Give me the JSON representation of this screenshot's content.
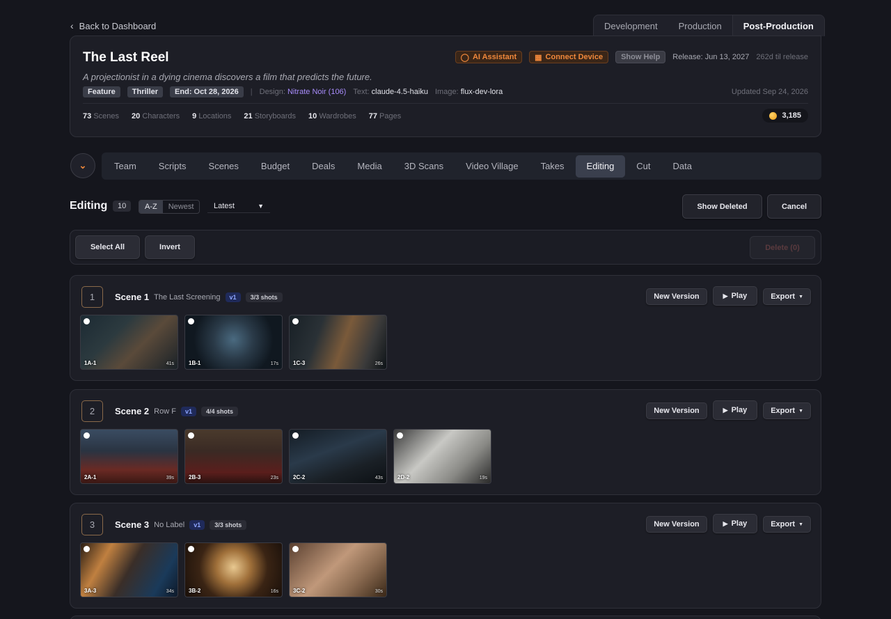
{
  "back_label": "Back to Dashboard",
  "phases": [
    "Development",
    "Production",
    "Post-Production"
  ],
  "active_phase": "Post-Production",
  "project": {
    "title": "The Last Reel",
    "tagline": "A projectionist in a dying cinema discovers a film that predicts the future.",
    "ai_assistant": "AI Assistant",
    "connect_device": "Connect Device",
    "show_help": "Show Help",
    "release": "Release: Jun 13, 2027",
    "countdown": "262d til release",
    "tags": [
      "Feature",
      "Thriller",
      "End: Oct 28, 2026"
    ],
    "design_label": "Design:",
    "design_value": "Nitrate Noir (106)",
    "text_label": "Text:",
    "text_value": "claude-4.5-haiku",
    "image_label": "Image:",
    "image_value": "flux-dev-lora",
    "updated": "Updated Sep 24, 2026",
    "stats": [
      {
        "n": "73",
        "label": "Scenes"
      },
      {
        "n": "20",
        "label": "Characters"
      },
      {
        "n": "9",
        "label": "Locations"
      },
      {
        "n": "21",
        "label": "Storyboards"
      },
      {
        "n": "10",
        "label": "Wardrobes"
      },
      {
        "n": "77",
        "label": "Pages"
      }
    ],
    "coins": "3,185"
  },
  "nav": [
    "Team",
    "Scripts",
    "Scenes",
    "Budget",
    "Deals",
    "Media",
    "3D Scans",
    "Video Village",
    "Takes",
    "Editing",
    "Cut",
    "Data"
  ],
  "active_nav": "Editing",
  "editing": {
    "title": "Editing",
    "count": "10",
    "sort_az": "A-Z",
    "sort_newest": "Newest",
    "select_value": "Latest",
    "show_deleted": "Show Deleted",
    "cancel": "Cancel",
    "select_all": "Select All",
    "invert": "Invert",
    "delete": "Delete (0)"
  },
  "scene_actions": {
    "new_version": "New Version",
    "play": "Play",
    "export": "Export"
  },
  "scenes": [
    {
      "num": "1",
      "name": "Scene 1",
      "label": "The Last Screening",
      "version": "v1",
      "shots": "3/3 shots",
      "thumbs": [
        {
          "code": "1A-1",
          "dur": "41s",
          "bg": "linear-gradient(135deg,#1c2a33 0%,#2c3a3f 35%,#5a4a3a 60%,#1a2228 100%)"
        },
        {
          "code": "1B-1",
          "dur": "17s",
          "bg": "radial-gradient(circle at 50% 45%,#4a6a80 0%,#2a3a48 35%,#101820 70%)"
        },
        {
          "code": "1C-3",
          "dur": "26s",
          "bg": "linear-gradient(110deg,#182026 0%,#2a3136 30%,#7a5a3a 55%,#3a3a3a 80%,#0e1418 100%)"
        }
      ]
    },
    {
      "num": "2",
      "name": "Scene 2",
      "label": "Row F",
      "version": "v1",
      "shots": "4/4 shots",
      "thumbs": [
        {
          "code": "2A-1",
          "dur": "39s",
          "bg": "linear-gradient(180deg,#3a4c62 0%,#2a3442 40%,#6a2a24 75%,#3a1814 100%)"
        },
        {
          "code": "2B-3",
          "dur": "23s",
          "bg": "linear-gradient(180deg,#4a3a2c 0%,#3a2a24 40%,#5a1e1c 80%,#2a1210 100%)"
        },
        {
          "code": "2C-2",
          "dur": "43s",
          "bg": "linear-gradient(160deg,#141c24 0%,#2a3a4a 40%,#1a2026 70%,#0c1014 100%)"
        },
        {
          "code": "2D-2",
          "dur": "19s",
          "bg": "linear-gradient(135deg,#3a3a3a 0%,#c8c8c4 40%,#8a8a86 70%,#2a2a2a 100%)"
        }
      ]
    },
    {
      "num": "3",
      "name": "Scene 3",
      "label": "No Label",
      "version": "v1",
      "shots": "3/3 shots",
      "thumbs": [
        {
          "code": "3A-3",
          "dur": "34s",
          "bg": "linear-gradient(120deg,#2a1e14 0%,#c08040 25%,#3a2e28 50%,#1a3a5a 80%,#0e1a2a 100%)"
        },
        {
          "code": "3B-2",
          "dur": "16s",
          "bg": "radial-gradient(circle at 50% 45%,#e8c890 0%,#a0703a 30%,#3a2414 60%,#1a100a 100%)"
        },
        {
          "code": "3C-2",
          "dur": "30s",
          "bg": "linear-gradient(135deg,#5a4030 0%,#c0987a 45%,#8a6a50 70%,#3a2818 100%)"
        }
      ]
    }
  ]
}
